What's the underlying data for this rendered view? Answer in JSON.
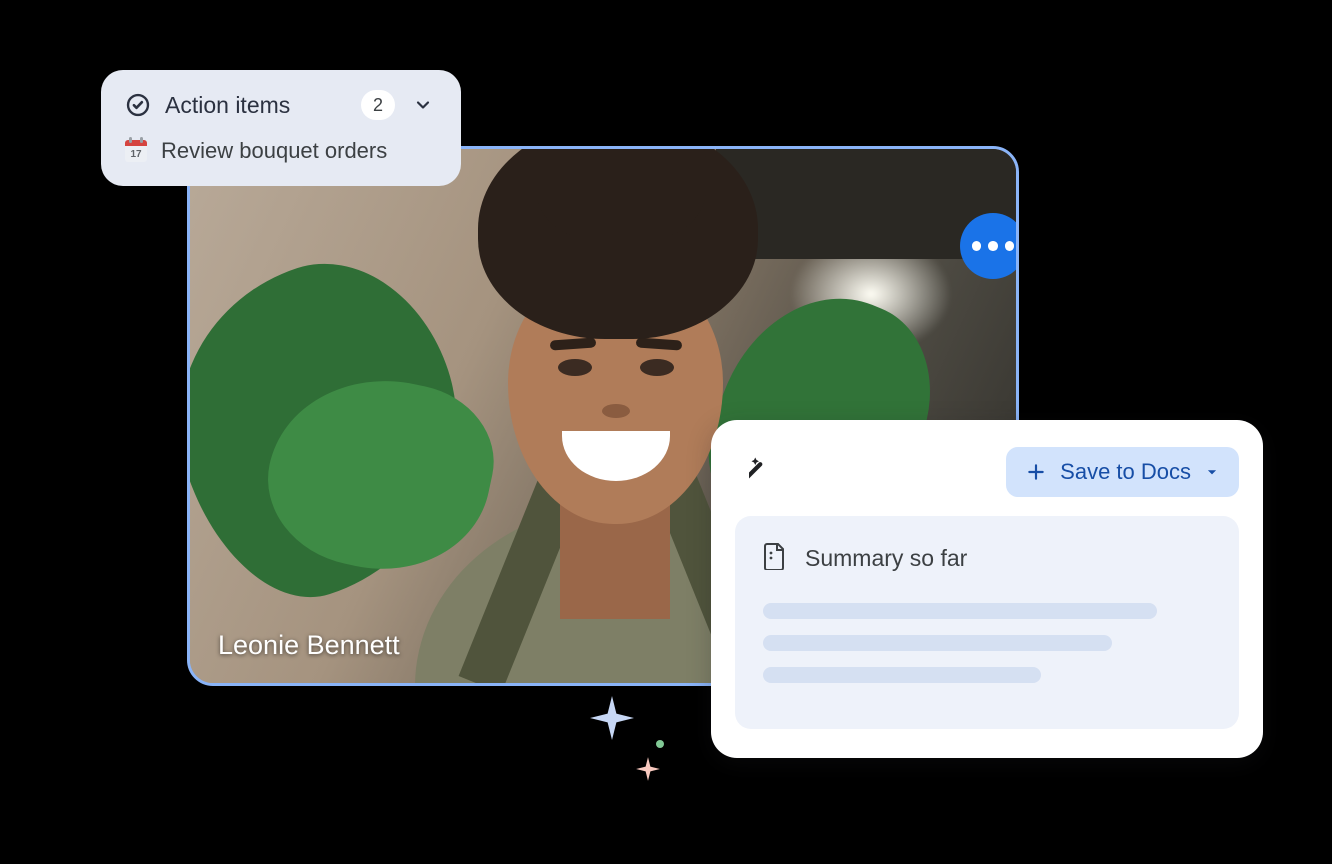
{
  "video": {
    "participant_name": "Leonie Bennett"
  },
  "action_items": {
    "title": "Action items",
    "count": "2",
    "items": [
      {
        "calendar_day": "17",
        "text": "Review bouquet orders"
      }
    ]
  },
  "summary": {
    "save_label": "Save to Docs",
    "body_title": "Summary so far",
    "placeholder_line_widths": [
      "88%",
      "78%",
      "62%"
    ]
  }
}
